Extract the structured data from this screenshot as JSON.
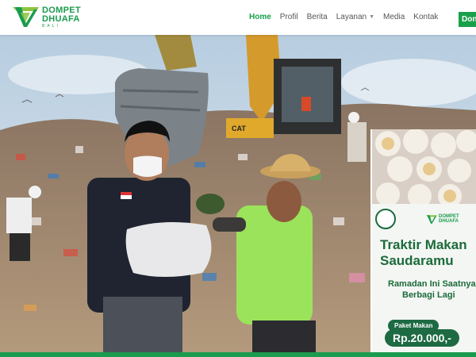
{
  "brand": {
    "line1": "DOMPET",
    "line2": "DHUAFA",
    "line3": "BALI"
  },
  "nav": {
    "items": [
      {
        "label": "Home",
        "active": true
      },
      {
        "label": "Profil"
      },
      {
        "label": "Berita"
      },
      {
        "label": "Layanan",
        "has_caret": true
      },
      {
        "label": "Media"
      },
      {
        "label": "Kontak"
      }
    ],
    "cta_label": "Donasi"
  },
  "hero": {
    "scene": "excavator-landfill-charity-photo",
    "poster": {
      "title_line1": "Traktir Makan",
      "title_line2": "Saudaramu",
      "subtitle_line1": "Ramadan Ini Saatnya",
      "subtitle_line2": "Berbagi Lagi",
      "package_label": "Paket Makan",
      "price": "Rp.20.000,-",
      "logo_text1": "DOMPET",
      "logo_text2": "DHUAFA"
    }
  },
  "colors": {
    "accent": "#1aa04b",
    "brand_dark": "#1d6a43",
    "sky": "#c9d8e4",
    "shirt_green": "#9be35a"
  }
}
